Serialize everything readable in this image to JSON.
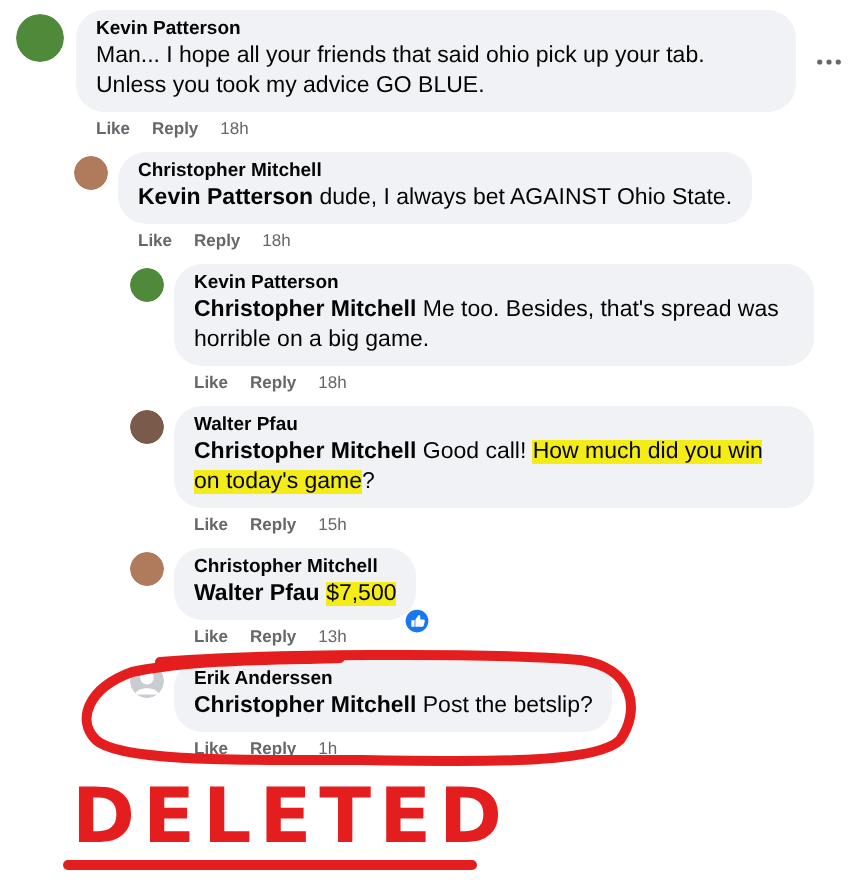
{
  "comments": [
    {
      "author": "Kevin Patterson",
      "avatar": {
        "kind": "photo",
        "color": "#4f8a3a"
      },
      "body": [
        {
          "kind": "plain",
          "text": "Man... I hope all your friends that said ohio pick up your tab. Unless you took my advice GO BLUE."
        }
      ],
      "actions": [
        "Like",
        "Reply"
      ],
      "time": "18h",
      "liked": false,
      "circled": false,
      "has_menu": true,
      "children": [
        {
          "author": "Christopher Mitchell",
          "avatar": {
            "kind": "photo",
            "color": "#b07a5c"
          },
          "body": [
            {
              "kind": "mention",
              "text": "Kevin Patterson"
            },
            {
              "kind": "plain",
              "text": " dude, I always bet AGAINST Ohio State."
            }
          ],
          "actions": [
            "Like",
            "Reply"
          ],
          "time": "18h",
          "liked": false,
          "circled": false,
          "has_menu": false,
          "children": [
            {
              "author": "Kevin Patterson",
              "avatar": {
                "kind": "photo",
                "color": "#4f8a3a"
              },
              "body": [
                {
                  "kind": "mention",
                  "text": "Christopher Mitchell"
                },
                {
                  "kind": "plain",
                  "text": " Me too. Besides, that's spread was horrible on a big game."
                }
              ],
              "actions": [
                "Like",
                "Reply"
              ],
              "time": "18h",
              "liked": false,
              "circled": false,
              "has_menu": false
            },
            {
              "author": "Walter Pfau",
              "avatar": {
                "kind": "photo",
                "color": "#7a5a4a"
              },
              "body": [
                {
                  "kind": "mention",
                  "text": "Christopher Mitchell"
                },
                {
                  "kind": "plain",
                  "text": " Good call! "
                },
                {
                  "kind": "highlight",
                  "text": "How much did you win on today's game"
                },
                {
                  "kind": "plain",
                  "text": "?"
                }
              ],
              "actions": [
                "Like",
                "Reply"
              ],
              "time": "15h",
              "liked": false,
              "circled": false,
              "has_menu": false
            },
            {
              "author": "Christopher Mitchell",
              "avatar": {
                "kind": "photo",
                "color": "#b07a5c"
              },
              "body": [
                {
                  "kind": "mention",
                  "text": "Walter Pfau"
                },
                {
                  "kind": "highlight",
                  "text": "$7,500"
                }
              ],
              "actions": [
                "Like",
                "Reply"
              ],
              "time": "13h",
              "liked": true,
              "circled": false,
              "has_menu": false
            },
            {
              "author": "Erik Anderssen",
              "avatar": {
                "kind": "default",
                "color": "#c9ccd1"
              },
              "body": [
                {
                  "kind": "mention",
                  "text": "Christopher Mitchell"
                },
                {
                  "kind": "plain",
                  "text": " Post the betslip?"
                }
              ],
              "actions": [
                "Like",
                "Reply"
              ],
              "time": "1h",
              "liked": false,
              "circled": true,
              "has_menu": false
            }
          ]
        }
      ]
    }
  ],
  "annotation": {
    "text": "DELETED",
    "underlined": true
  }
}
